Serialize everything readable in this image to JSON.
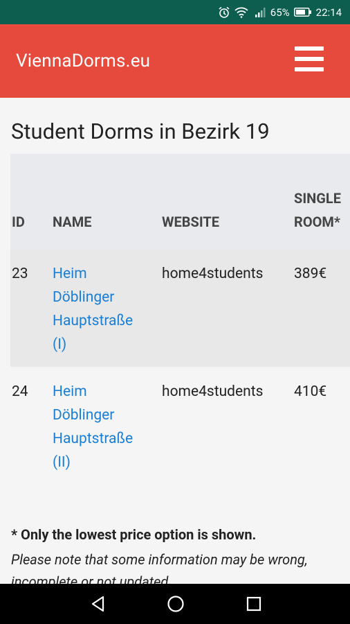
{
  "status_bar": {
    "battery_percent": "65%",
    "time": "22:14",
    "icons": [
      "alarm-icon",
      "wifi-icon",
      "signal-icon",
      "battery-icon"
    ]
  },
  "app_bar": {
    "brand": "ViennaDorms.eu",
    "menu_icon": "hamburger-menu-icon",
    "color": "#e64a3d"
  },
  "page": {
    "title": "Student Dorms in Bezirk 19"
  },
  "table": {
    "headers": {
      "id": "ID",
      "name": "NAME",
      "website": "WEBSITE",
      "single_line1": "SINGLE",
      "single_line2": "ROOM*"
    },
    "rows": [
      {
        "id": "23",
        "name_lines": [
          "Heim",
          "Döblinger",
          "Hauptstraße",
          "(I)"
        ],
        "website": "home4students",
        "price": "389€"
      },
      {
        "id": "24",
        "name_lines": [
          "Heim",
          "Döblinger",
          "Hauptstraße",
          "(II)"
        ],
        "website": "home4students",
        "price": "410€"
      }
    ]
  },
  "footer": {
    "footnote": "* Only the lowest price option is shown.",
    "note_line1": "Please note that some information may be wrong,",
    "note_line2": "incomplete or not updated."
  },
  "nav_bar": {
    "icons": [
      "back-icon",
      "home-icon",
      "recents-icon"
    ]
  }
}
